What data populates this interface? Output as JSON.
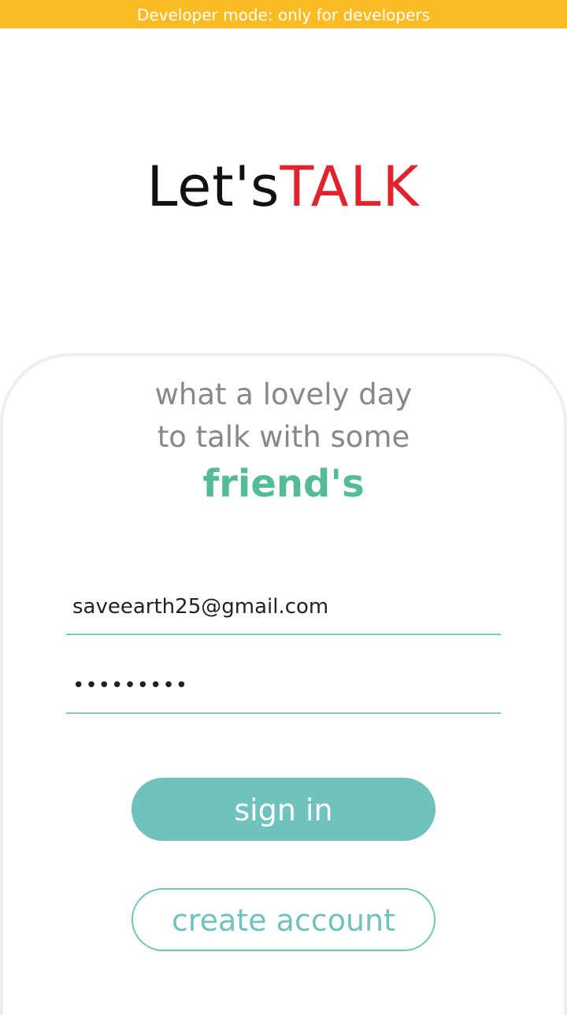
{
  "banner": {
    "text": "Developer mode: only for developers"
  },
  "logo": {
    "part1": "Let's",
    "part2": "TALK"
  },
  "greeting": {
    "line1": "what a lovely day",
    "line2": "to talk with some",
    "highlight": "friend's"
  },
  "form": {
    "email_value": "saveearth25@gmail.com",
    "password_value": "•••••••••"
  },
  "buttons": {
    "signin_label": "sign in",
    "create_label": "create account"
  },
  "colors": {
    "banner": "#fbbb22",
    "logo_talk": "#e0242e",
    "highlight": "#55bb95",
    "accent": "#70c2bc"
  }
}
